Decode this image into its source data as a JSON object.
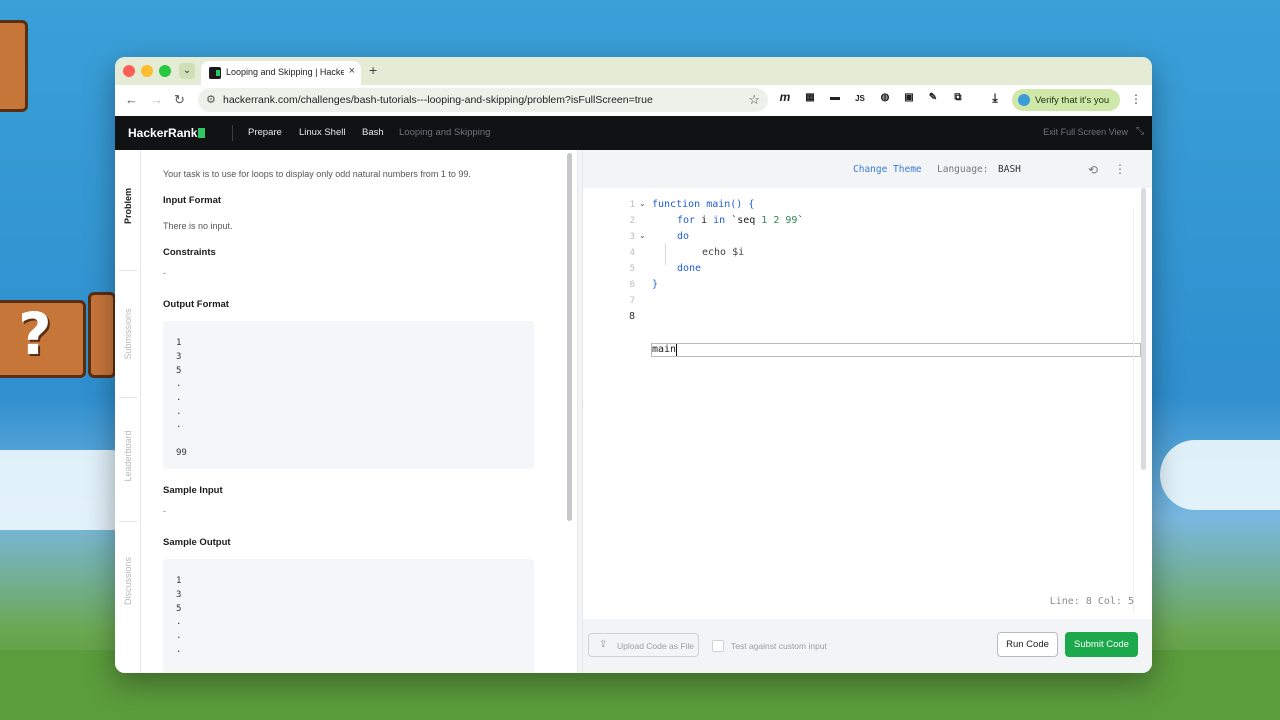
{
  "browser": {
    "tab_title": "Looping and Skipping | HackerRank",
    "tab_close": "×",
    "new_tab": "+",
    "tab_dropdown": "⌄",
    "url": "hackerrank.com/challenges/bash-tutorials---looping-and-skipping/problem?isFullScreen=true",
    "nav": {
      "back": "←",
      "forward": "→",
      "reload": "↻"
    },
    "bookmark_star": "☆",
    "extensions": [
      "m",
      "▦",
      "▬",
      "JS",
      "◍",
      "▣",
      "✎",
      "⧉"
    ],
    "download_icon": "⤓",
    "verify_label": "Verify that it's you",
    "more_menu": "⋮",
    "colors": {
      "close": "#ff5f57",
      "minimize": "#febc2e",
      "maximize": "#28c840"
    }
  },
  "header": {
    "logo": "HackerRank",
    "crumbs": [
      "Prepare",
      "Linux Shell",
      "Bash",
      "Looping and Skipping"
    ],
    "exit_full_screen": "Exit Full Screen View",
    "exit_icon": "⤡"
  },
  "side_tabs": [
    "Problem",
    "Submissions",
    "Leaderboard",
    "Discussions"
  ],
  "problem": {
    "task_text": "Your task is to use for loops to display only odd natural numbers from 1 to 99.",
    "input_format_title": "Input Format",
    "input_format_text": "There is no input.",
    "constraints_title": "Constraints",
    "constraints_text": "-",
    "output_format_title": "Output Format",
    "output_format_lines": [
      "1",
      "3",
      "5",
      ".",
      ".",
      ".",
      ".",
      "99"
    ],
    "sample_input_title": "Sample Input",
    "sample_input_text": "-",
    "sample_output_title": "Sample Output",
    "sample_output_lines": [
      "1",
      "3",
      "5",
      ".",
      ".",
      "."
    ]
  },
  "editor": {
    "change_theme": "Change Theme",
    "language_label": "Language:",
    "language_value": "BASH",
    "history_icon": "⟲",
    "menu_icon": "⋮",
    "line_numbers": [
      "1",
      "2",
      "3",
      "4",
      "5",
      "6",
      "7",
      "8"
    ],
    "fold_marker": "⌄",
    "code": {
      "l1_kw": "function",
      "l1_rest": " main() {",
      "l2_kw1": "for",
      "l2_mid": " i ",
      "l2_kw2": "in",
      "l2_str1": " `seq",
      "l2_num": " 1 2 99",
      "l2_str2": "`",
      "l3_kw": "do",
      "l4": "echo $i",
      "l5_kw": "done",
      "l6": "}",
      "l8": "main"
    },
    "status": "Line: 8 Col: 5"
  },
  "actions": {
    "upload_icon": "⇪",
    "upload_label": "Upload Code as File",
    "custom_input_label": "Test against custom input",
    "run_label": "Run Code",
    "submit_label": "Submit Code"
  }
}
